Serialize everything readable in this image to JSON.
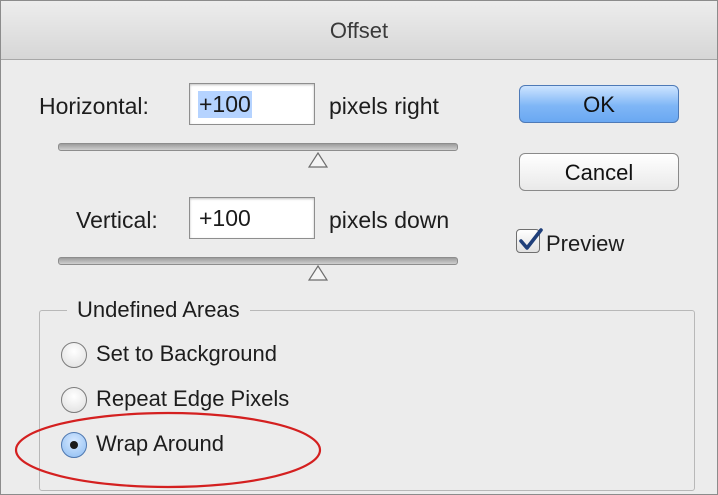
{
  "dialog": {
    "title": "Offset"
  },
  "horizontal": {
    "label": "Horizontal:",
    "value": "+100",
    "unit": "pixels right",
    "slider_level": 0.67
  },
  "vertical": {
    "label": "Vertical:",
    "value": "+100",
    "unit": "pixels down",
    "slider_level": 0.67
  },
  "buttons": {
    "ok": "OK",
    "cancel": "Cancel"
  },
  "preview": {
    "label": "Preview",
    "checked": true
  },
  "undefined_areas": {
    "title": "Undefined Areas",
    "options": [
      {
        "label": "Set to Background",
        "selected": false
      },
      {
        "label": "Repeat Edge Pixels",
        "selected": false
      },
      {
        "label": "Wrap Around",
        "selected": true
      }
    ]
  },
  "colors": {
    "default_button": "#7fb6f6",
    "highlight_ellipse": "#d42020",
    "selection": "#b5d3ff"
  }
}
